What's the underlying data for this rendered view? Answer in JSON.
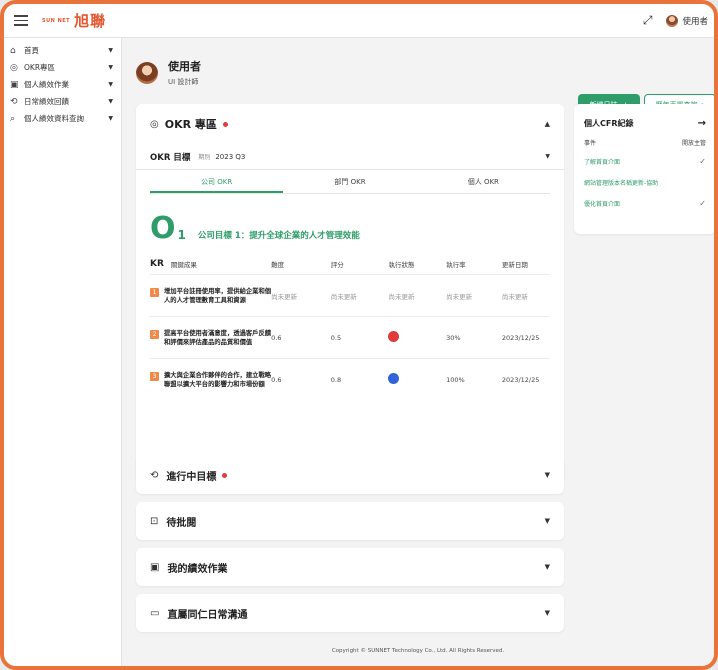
{
  "topbar": {
    "logo_small": "SUN NET",
    "logo_big": "旭聯",
    "user_name": "使用者"
  },
  "sidebar": {
    "items": [
      {
        "label": "首頁",
        "icon": "home-icon",
        "glyph": "⌂"
      },
      {
        "label": "OKR專區",
        "icon": "target-icon",
        "glyph": "◎"
      },
      {
        "label": "個人績效作業",
        "icon": "report-icon",
        "glyph": "▣"
      },
      {
        "label": "日常績效回饋",
        "icon": "sync-icon",
        "glyph": "⟲"
      },
      {
        "label": "個人績效資料查詢",
        "icon": "search-icon",
        "glyph": "⌕"
      }
    ]
  },
  "profile": {
    "name": "使用者",
    "role": "UI 設計師"
  },
  "actions": {
    "add_log": "新增日誌",
    "year_query": "歷年表單查詢"
  },
  "okr": {
    "title": "OKR 專區",
    "target_label": "OKR 目標",
    "period_label": "期別",
    "period_value": "2023 Q3",
    "tabs": [
      "公司 OKR",
      "部門 OKR",
      "個人 OKR"
    ],
    "objective_letter": "O",
    "objective_number": "1",
    "objective_text": "公司目標 1：提升全球企業的人才管理效能",
    "kr_head": {
      "kr": "KR",
      "kr_sub": "關鍵成果",
      "difficulty": "難度",
      "score": "評分",
      "status": "執行狀態",
      "rate": "執行率",
      "date": "更新日期"
    },
    "rows": [
      {
        "num": "1",
        "text": "增加平台註冊使用率，提供給企業和個人的人才管理數育工具和資源",
        "difficulty": "尚未更新",
        "score": "尚未更新",
        "status": "尚未更新",
        "status_color": "",
        "rate": "尚未更新",
        "date": "尚未更新"
      },
      {
        "num": "2",
        "text": "提高平台使用者滿意度，透過客戶反饋和評價來評估產品的品質和價值",
        "difficulty": "0.6",
        "score": "0.5",
        "status": "",
        "status_color": "#e03a3a",
        "rate": "30%",
        "date": "2023/12/25"
      },
      {
        "num": "3",
        "text": "擴大與企業合作夥伴的合作，建立戰略聯盟以擴大平台的影響力和市場份額",
        "difficulty": "0.6",
        "score": "0.8",
        "status": "",
        "status_color": "#2f64d6",
        "rate": "100%",
        "date": "2023/12/25"
      }
    ]
  },
  "sections": [
    {
      "title": "進行中目標",
      "icon": "sync-icon",
      "glyph": "⟲",
      "dot": true
    },
    {
      "title": "待批閱",
      "icon": "pending-icon",
      "glyph": "⊡",
      "dot": false
    },
    {
      "title": "我的績效作業",
      "icon": "report-icon",
      "glyph": "▣",
      "dot": false
    },
    {
      "title": "直屬同仁日常溝通",
      "icon": "chat-icon",
      "glyph": "▭",
      "dot": false
    }
  ],
  "cfr": {
    "title": "個人CFR紀錄",
    "col_event": "事件",
    "col_open": "開放主管",
    "items": [
      {
        "label": "了解首頁介面",
        "checked": true
      },
      {
        "label": "網站管理版本名稱更新-協助",
        "checked": false
      },
      {
        "label": "優化首頁介面",
        "checked": true
      }
    ]
  },
  "footer": "Copyright © SUNNET Technology Co., Ltd. All Rights Reserved."
}
